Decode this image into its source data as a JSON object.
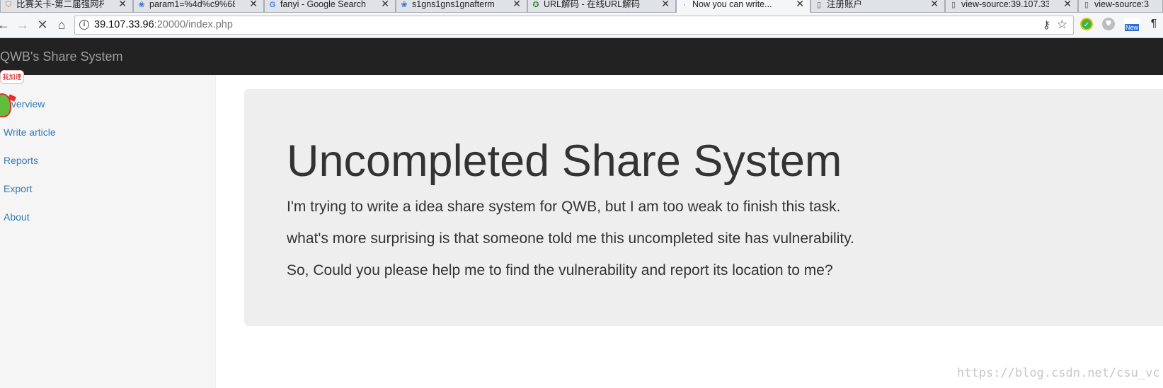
{
  "browser": {
    "tabs": [
      {
        "label": "比赛关卡-第二届强网杯2",
        "icon": "shield-icon",
        "active": false
      },
      {
        "label": "param1=%4d%c9%68%",
        "icon": "paw-icon",
        "active": false
      },
      {
        "label": "fanyi - Google Search",
        "icon": "google-icon",
        "active": false
      },
      {
        "label": "s1gns1gns1gnafterm",
        "icon": "paw-icon",
        "active": false
      },
      {
        "label": "URL解码 - 在线URL解码",
        "icon": "globe-icon",
        "active": false
      },
      {
        "label": "Now you can write...",
        "icon": "loading-icon",
        "active": true
      },
      {
        "label": "注册账户",
        "icon": "document-icon",
        "active": false
      },
      {
        "label": "view-source:39.107.33",
        "icon": "document-icon",
        "active": false
      },
      {
        "label": "view-source:3",
        "icon": "document-icon",
        "active": false
      }
    ],
    "url_host": "39.107.33.96",
    "url_rest": ":20000/index.php",
    "extensions": [
      "360-icon",
      "shield-ext-icon",
      "new-ext-icon",
      "paragraph-icon"
    ],
    "new_badge": "New"
  },
  "navbar": {
    "brand": "QWB's Share System"
  },
  "sidebar": {
    "items": [
      {
        "label": "Overview"
      },
      {
        "label": "Write article"
      },
      {
        "label": "Reports"
      },
      {
        "label": "Export"
      },
      {
        "label": "About"
      }
    ],
    "overlay_badge": "我加速"
  },
  "main": {
    "heading": "Uncompleted Share System",
    "paragraphs": [
      "I'm trying to write a idea share system for QWB, but I am too weak to finish this task.",
      "what's more surprising is that someone told me this uncompleted site has vulnerability.",
      "So, Could you please help me to find the vulnerability and report its location to me?"
    ]
  },
  "watermark": "https://blog.csdn.net/csu_vc"
}
